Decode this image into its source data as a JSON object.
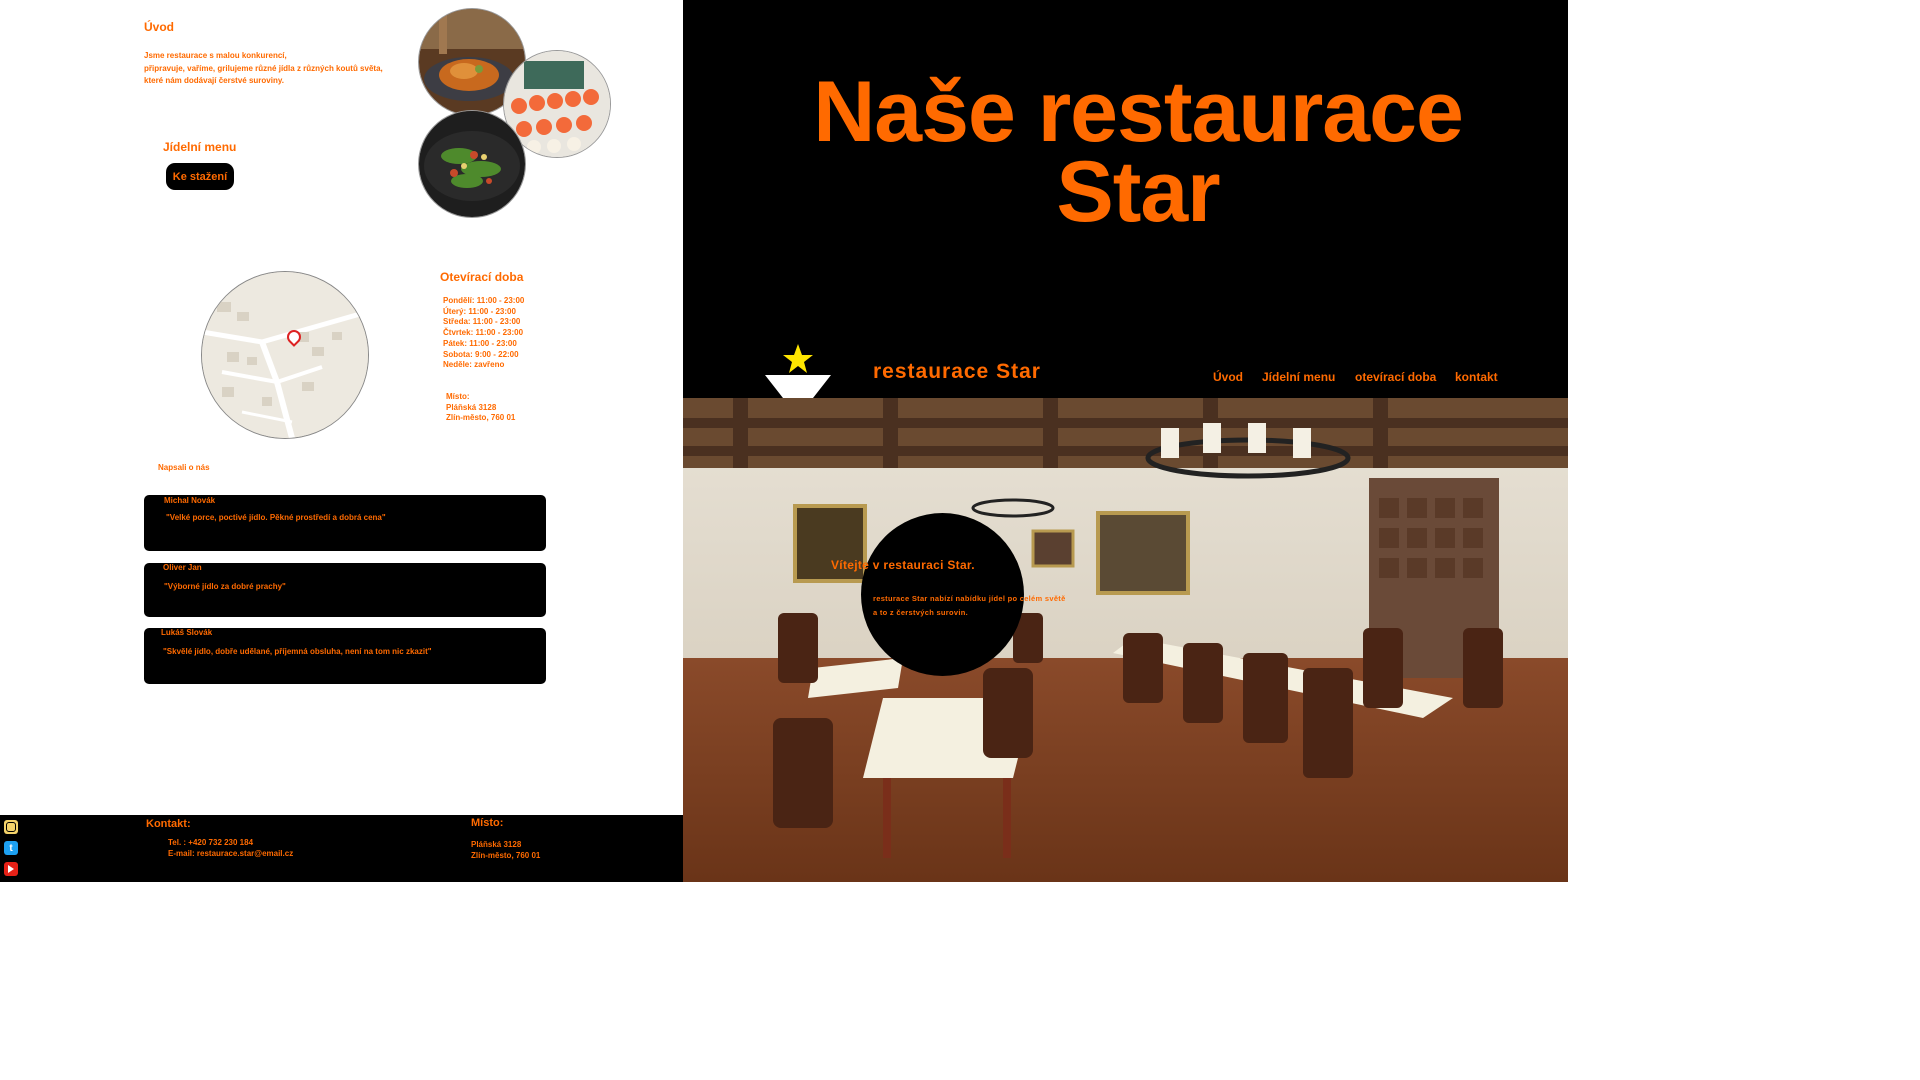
{
  "intro": {
    "title": "Úvod",
    "text_lines": [
      "Jsme restaurace s malou konkurencí,",
      "připravuje, vaříme, grilujeme různé jídla z různých koutů světa,",
      "které nám dodávají čerstvé suroviny."
    ]
  },
  "menu": {
    "title": "Jídelní menu",
    "download_label": "Ke stažení"
  },
  "hours": {
    "title": "Otevírací doba",
    "lines": [
      "Pondělí: 11:00 - 23:00",
      "Úterý: 11:00 - 23:00",
      "Středa: 11:00 - 23:00",
      "Čtvrtek: 11:00 - 23:00",
      "Pátek: 11:00 - 23:00",
      "Sobota: 9:00 - 22:00",
      "Neděle: zavřeno"
    ],
    "place_label": "Místo:",
    "place_lines": [
      "Pláňská 3128",
      "Zlín-město, 760 01"
    ]
  },
  "reviews": {
    "title": "Napsali o nás",
    "items": [
      {
        "name": "Michal Novák",
        "quote": "\"Velké porce, poctivé jídlo. Pěkné prostředí a dobrá cena\""
      },
      {
        "name": "Oliver Jan",
        "quote": "\"Výborné jídlo za dobré prachy\""
      },
      {
        "name": "Lukáš Slovák",
        "quote": "\"Skvělé jídlo, dobře udělané, příjemná obsluha, není na tom nic zkazit\""
      }
    ]
  },
  "footer": {
    "contact_label": "Kontakt:",
    "phone": "Tel. : +420 732 230 184",
    "email": "E-mail: restaurace.star@email.cz",
    "place_label": "Místo:",
    "place_lines": [
      "Pláňská 3128",
      "Zlín-město, 760 01"
    ],
    "social_icons": [
      "instagram-icon",
      "twitter-icon",
      "youtube-icon"
    ]
  },
  "hero": {
    "title_line1": "Naše restaurace",
    "title_line2": "Star"
  },
  "navbar": {
    "brand": "restaurace Star",
    "links": [
      "Úvod",
      "Jídelní menu",
      "otevírací doba",
      "kontakt"
    ]
  },
  "welcome": {
    "title": "Vítejte v restauraci Star.",
    "text_lines": [
      "resturace Star nabízí nabídku jídel po celém světě",
      "a to z čerstvých surovin."
    ]
  },
  "colors": {
    "accent": "#ff6a00",
    "background_dark": "#000000",
    "star": "#ffe600"
  }
}
